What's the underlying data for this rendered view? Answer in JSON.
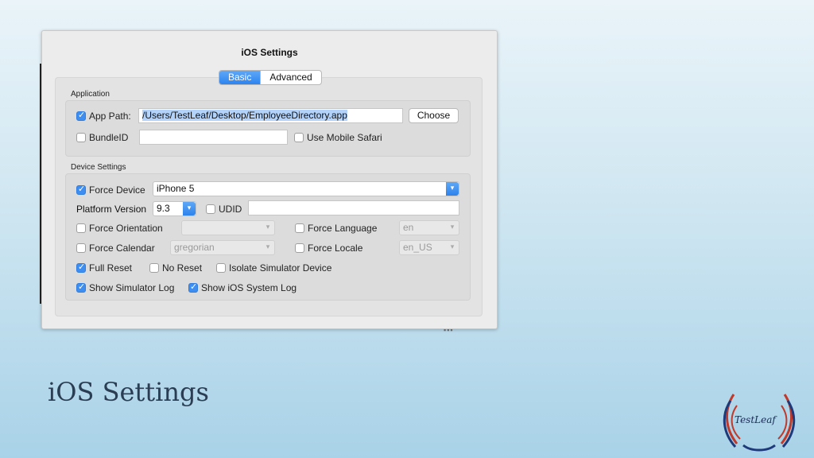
{
  "window": {
    "title": "iOS Settings"
  },
  "tabs": [
    {
      "label": "Basic",
      "active": true
    },
    {
      "label": "Advanced",
      "active": false
    }
  ],
  "application": {
    "label": "Application",
    "app_path_label": "App Path:",
    "app_path_value": "/Users/TestLeaf/Desktop/EmployeeDirectory.app",
    "choose_label": "Choose",
    "bundle_id_label": "BundleID",
    "bundle_id_value": "",
    "mobile_safari_label": "Use Mobile Safari"
  },
  "device": {
    "label": "Device Settings",
    "force_device_label": "Force Device",
    "device_value": "iPhone 5",
    "platform_version_label": "Platform Version",
    "platform_version_value": "9.3",
    "udid_label": "UDID",
    "udid_value": "",
    "force_orientation_label": "Force Orientation",
    "orientation_value": "",
    "force_language_label": "Force Language",
    "language_value": "en",
    "force_calendar_label": "Force Calendar",
    "calendar_value": "gregorian",
    "force_locale_label": "Force Locale",
    "locale_value": "en_US",
    "full_reset_label": "Full Reset",
    "no_reset_label": "No Reset",
    "isolate_label": "Isolate Simulator Device",
    "sim_log_label": "Show Simulator Log",
    "ios_log_label": "Show iOS System Log"
  },
  "caption": "iOS Settings",
  "logo_text": "TestLeaf",
  "colors": {
    "accent": "#3d8ef0",
    "caption": "#2b3d52"
  }
}
